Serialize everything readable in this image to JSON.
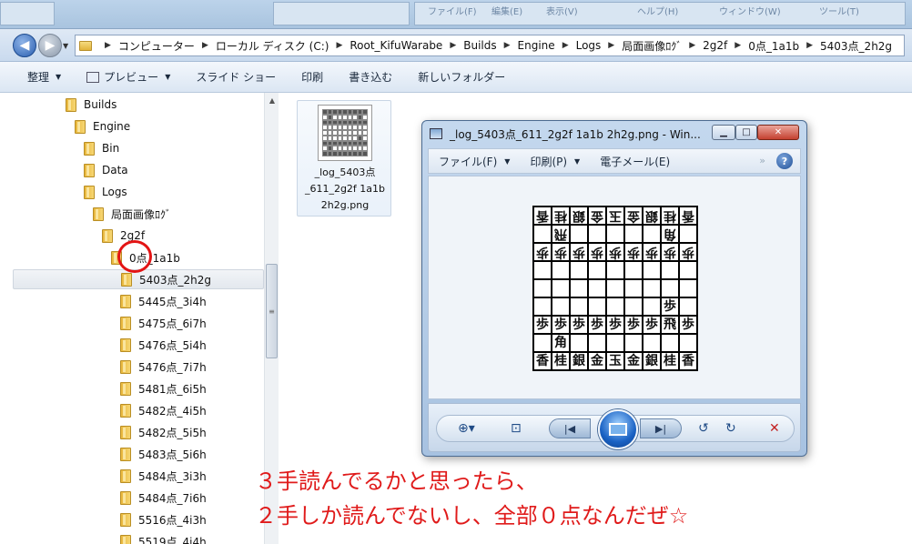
{
  "back_window": {
    "ghost_labels": [
      "ファイル(F)",
      "編集(E)",
      "表示(V)",
      "ヘルプ(H)",
      "ウィンドウ(W)",
      "ツール(T)"
    ]
  },
  "address": {
    "crumbs": [
      "コンピューター",
      "ローカル ディスク (C:)",
      "Root_KifuWarabe",
      "Builds",
      "Engine",
      "Logs",
      "局面画像ﾛｸﾞ",
      "2g2f",
      "0点_1a1b",
      "5403点_2h2g"
    ]
  },
  "toolbar": {
    "organize": "整理",
    "preview": "プレビュー",
    "slideshow": "スライド ショー",
    "print": "印刷",
    "burn": "書き込む",
    "new_folder": "新しいフォルダー"
  },
  "tree": [
    {
      "label": "Builds",
      "indent": 0
    },
    {
      "label": "Engine",
      "indent": 1
    },
    {
      "label": "Bin",
      "indent": 2
    },
    {
      "label": "Data",
      "indent": 2
    },
    {
      "label": "Logs",
      "indent": 2
    },
    {
      "label": "局面画像ﾛｸﾞ",
      "indent": 3
    },
    {
      "label": "2g2f",
      "indent": 4
    },
    {
      "label": "0点_1a1b",
      "indent": 5
    },
    {
      "label": "5403点_2h2g",
      "indent": 6,
      "selected": true
    },
    {
      "label": "5445点_3i4h",
      "indent": 6
    },
    {
      "label": "5475点_6i7h",
      "indent": 6
    },
    {
      "label": "5476点_5i4h",
      "indent": 6
    },
    {
      "label": "5476点_7i7h",
      "indent": 6
    },
    {
      "label": "5481点_6i5h",
      "indent": 6
    },
    {
      "label": "5482点_4i5h",
      "indent": 6
    },
    {
      "label": "5482点_5i5h",
      "indent": 6
    },
    {
      "label": "5483点_5i6h",
      "indent": 6
    },
    {
      "label": "5484点_3i3h",
      "indent": 6
    },
    {
      "label": "5484点_7i6h",
      "indent": 6
    },
    {
      "label": "5516点_4i3h",
      "indent": 6
    },
    {
      "label": "5519点_4i4h",
      "indent": 6
    }
  ],
  "file": {
    "label_lines": [
      "_log_5403点",
      "_611_2g2f 1a1b",
      "2h2g.png"
    ]
  },
  "viewer": {
    "title": "_log_5403点_611_2g2f 1a1b 2h2g.png - Win...",
    "menu": {
      "file": "ファイル(F)",
      "print": "印刷(P)",
      "email": "電子メール(E)"
    },
    "more": "»",
    "help": "?",
    "board": [
      [
        "香",
        "桂",
        "銀",
        "金",
        "玉",
        "金",
        "銀",
        "桂",
        "香"
      ],
      [
        "",
        "飛",
        "",
        "",
        "",
        "",
        "",
        "角",
        ""
      ],
      [
        "歩",
        "歩",
        "歩",
        "歩",
        "歩",
        "歩",
        "歩",
        "歩",
        "歩"
      ],
      [
        "",
        "",
        "",
        "",
        "",
        "",
        "",
        "",
        ""
      ],
      [
        "",
        "",
        "",
        "",
        "",
        "",
        "",
        "",
        ""
      ],
      [
        "",
        "",
        "",
        "",
        "",
        "",
        "",
        "歩",
        ""
      ],
      [
        "歩",
        "歩",
        "歩",
        "歩",
        "歩",
        "歩",
        "歩",
        "飛",
        "歩"
      ],
      [
        "",
        "角",
        "",
        "",
        "",
        "",
        "",
        "",
        ""
      ],
      [
        "香",
        "桂",
        "銀",
        "金",
        "玉",
        "金",
        "銀",
        "桂",
        "香"
      ]
    ],
    "gote_rows": [
      0,
      1,
      2
    ]
  },
  "annotation": {
    "line1": "３手読んでるかと思ったら、",
    "line2": "２手しか読んでないし、全部０点なんだぜ☆"
  }
}
